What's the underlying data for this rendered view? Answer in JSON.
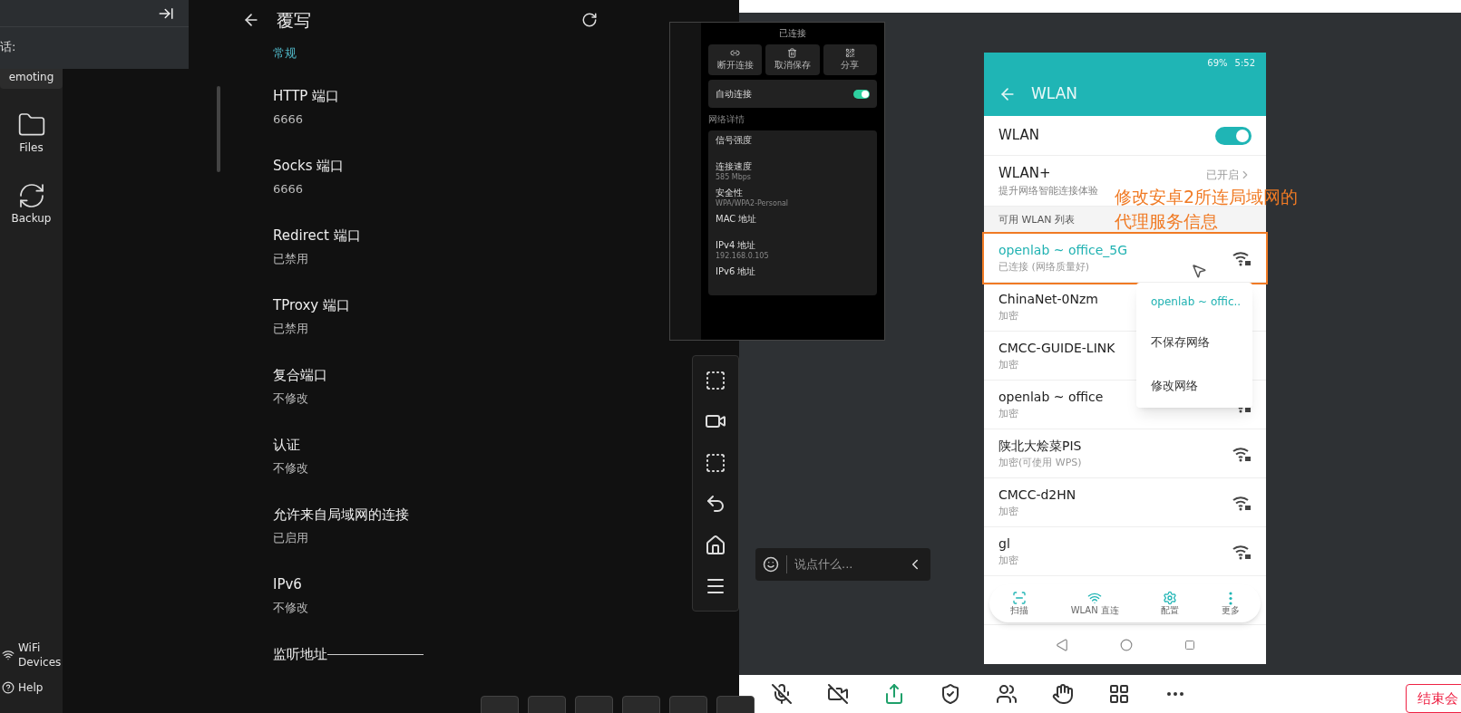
{
  "top_panel": {
    "label": "话:"
  },
  "sidebar": {
    "items": [
      {
        "label": "emoting",
        "selected": true
      },
      {
        "label": "Files",
        "selected": false
      },
      {
        "label": "Backup",
        "selected": false
      }
    ],
    "bottom_items": [
      {
        "label": "WiFi\nDevices"
      },
      {
        "label": "Help"
      }
    ]
  },
  "settings": {
    "title": "覆写",
    "section": "常规",
    "items": [
      {
        "title": "HTTP 端口",
        "value": "6666"
      },
      {
        "title": "Socks 端口",
        "value": "6666"
      },
      {
        "title": "Redirect 端口",
        "value": "已禁用"
      },
      {
        "title": "TProxy 端口",
        "value": "已禁用"
      },
      {
        "title": "复合端口",
        "value": "不修改"
      },
      {
        "title": "认证",
        "value": "不修改"
      },
      {
        "title": "允许来自局域网的连接",
        "value": "已启用"
      },
      {
        "title": "IPv6",
        "value": "不修改"
      },
      {
        "title": "监听地址"
      }
    ]
  },
  "mirror_window": {
    "title": "已连接",
    "actions": [
      "断开连接",
      "取消保存",
      "分享"
    ],
    "auto_connect": {
      "label": "自动连接",
      "on": true
    },
    "section": "网络详情",
    "details": [
      {
        "label": "信号强度"
      },
      {
        "label": "连接速度",
        "value": "585 Mbps"
      },
      {
        "label": "安全性",
        "value": "WPA/WPA2-Personal"
      },
      {
        "label": "MAC 地址"
      },
      {
        "label": "IPv4 地址",
        "value": "192.168.0.105"
      },
      {
        "label": "IPv6 地址"
      }
    ]
  },
  "chat": {
    "placeholder": "说点什么..."
  },
  "phone": {
    "status": {
      "battery": "69%",
      "time": "5:52"
    },
    "title": "WLAN",
    "wlan": {
      "label": "WLAN",
      "on": true
    },
    "wlan_plus": {
      "label": "WLAN+",
      "desc": "提升网络智能连接体验",
      "value": "已开启"
    },
    "list_title": "可用 WLAN 列表",
    "networks": [
      {
        "name": "openlab ~ office_5G",
        "status": "已连接 (网络质量好)",
        "selected": true
      },
      {
        "name": "ChinaNet-0Nzm",
        "status": "加密",
        "selected": false
      },
      {
        "name": "CMCC-GUIDE-LINK",
        "status": "加密",
        "selected": false
      },
      {
        "name": "openlab ~ office",
        "status": "加密",
        "selected": false
      },
      {
        "name": "陕北大烩菜PIS",
        "status": "加密(可使用 WPS)",
        "selected": false
      },
      {
        "name": "CMCC-d2HN",
        "status": "加密",
        "selected": false
      },
      {
        "name": "gl",
        "status": "加密",
        "selected": false
      }
    ],
    "menu": {
      "title": "openlab ~ offic..",
      "items": [
        "不保存网络",
        "修改网络"
      ]
    },
    "bottom_bar": [
      "扫描",
      "WLAN 直连",
      "配置",
      "更多"
    ]
  },
  "annotation": {
    "lines": [
      "修改安卓2所连局域网的",
      "代理服务信息"
    ]
  },
  "meeting_bar": {
    "end_button": "结束会"
  }
}
